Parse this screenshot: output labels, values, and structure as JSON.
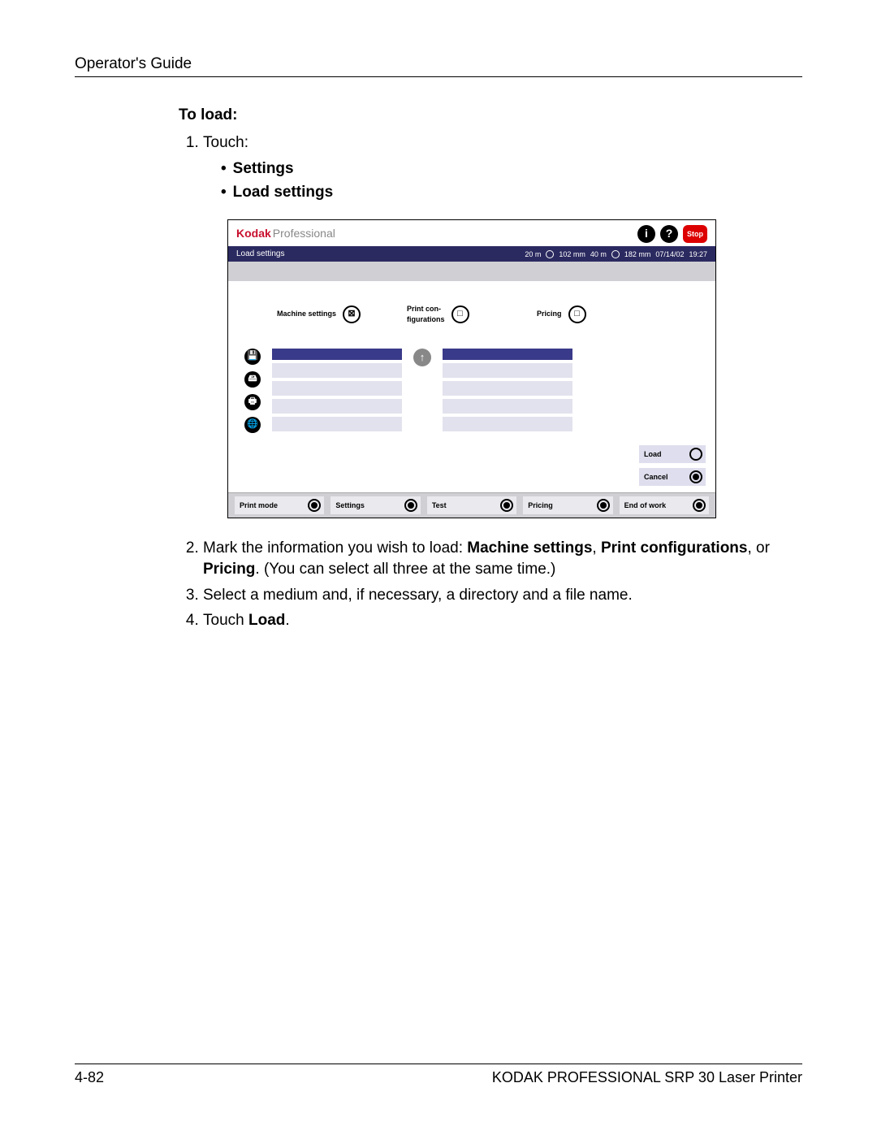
{
  "header": {
    "title": "Operator's Guide"
  },
  "section": {
    "heading": "To load:"
  },
  "step1": {
    "intro": "Touch:",
    "bullets": [
      "Settings",
      "Load settings"
    ]
  },
  "device": {
    "brand_k": "Kodak",
    "brand_p": "Professional",
    "info_glyph": "i",
    "help_glyph": "?",
    "stop": "Stop",
    "title": "Load settings",
    "status": {
      "s1a": "20 m",
      "s1b": "102 mm",
      "s2a": "40 m",
      "s2b": "182 mm",
      "date": "07/14/02",
      "time": "19:27"
    },
    "options": {
      "o1": "Machine settings",
      "o1_glyph": "⊠",
      "o2": "Print con-\nfigurations",
      "o2_glyph": "□",
      "o3": "Pricing",
      "o3_glyph": "□"
    },
    "side": {
      "i1": "💾",
      "i2": "🖴",
      "i3": "🖶",
      "i4": "🌐"
    },
    "mid_arrow": "↑",
    "actions": {
      "load": "Load",
      "cancel": "Cancel"
    },
    "bottom": {
      "b1": "Print mode",
      "b2": "Settings",
      "b3": "Test",
      "b4": "Pricing",
      "b5": "End of work"
    }
  },
  "steps_after": {
    "s2a": "Mark the information you wish to load: ",
    "s2b1": "Machine settings",
    "s2c": ", ",
    "s2b2": "Print configurations",
    "s2d": ", or ",
    "s2b3": "Pricing",
    "s2e": ". (You can select all three at the same time.)",
    "s3": "Select a medium and, if necessary, a directory and a file name.",
    "s4a": "Touch ",
    "s4b": "Load",
    "s4c": "."
  },
  "footer": {
    "page": "4-82",
    "product": "KODAK PROFESSIONAL SRP 30 Laser Printer"
  }
}
